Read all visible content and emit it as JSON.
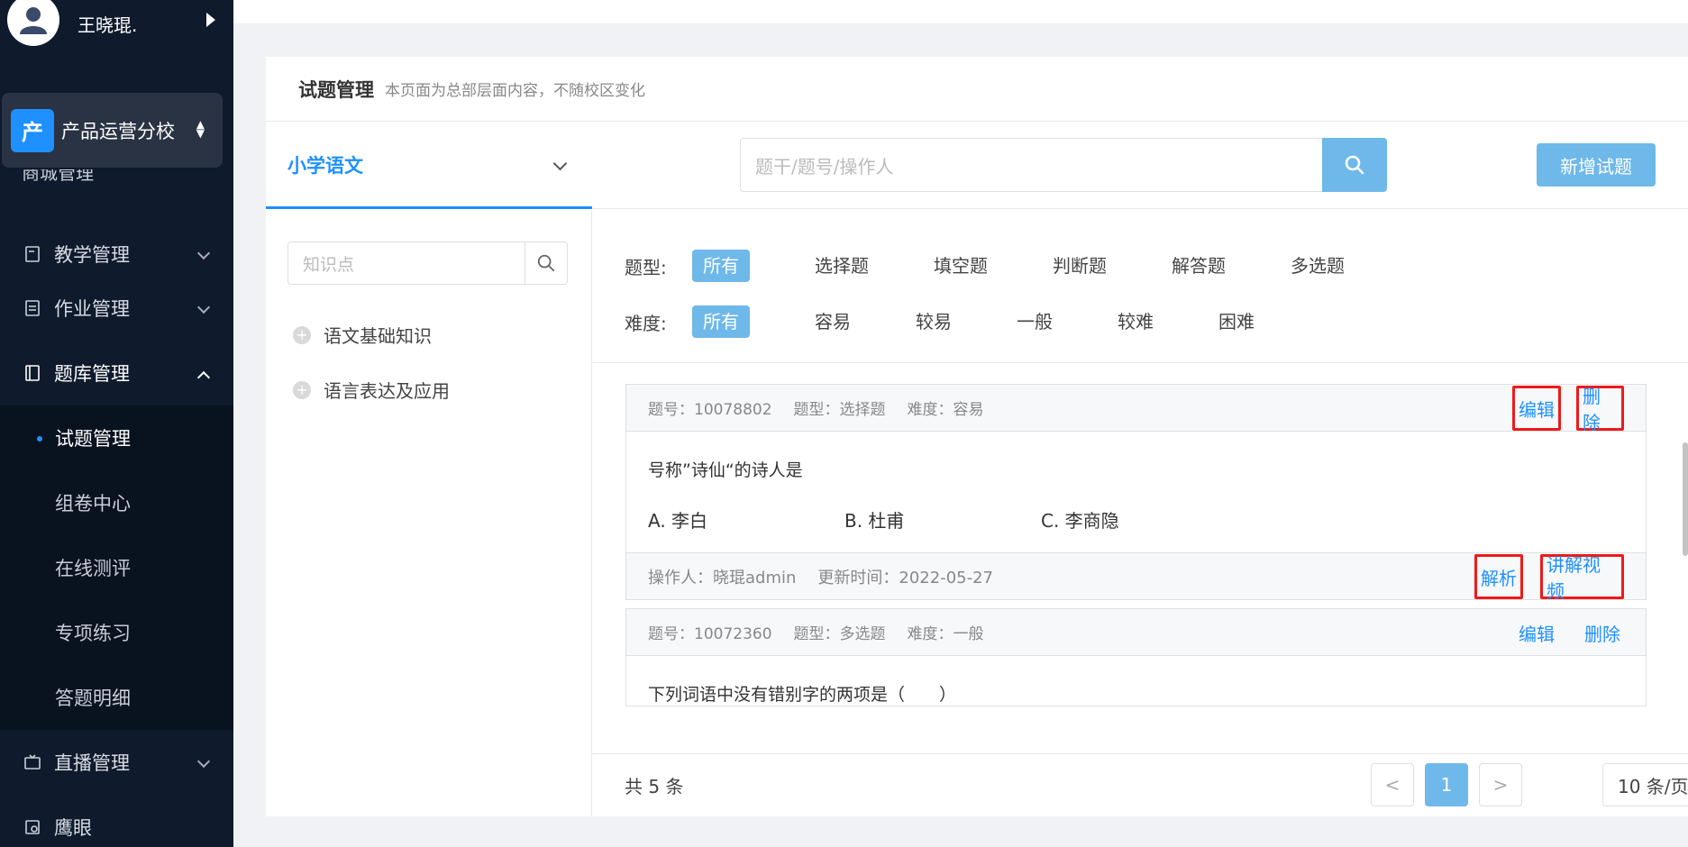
{
  "user": {
    "name": "王晓琨."
  },
  "school": {
    "logo_char": "产",
    "name": "产品运营分校"
  },
  "sidebar": {
    "partial_item": "商城管理",
    "items": [
      {
        "label": "教学管理"
      },
      {
        "label": "作业管理"
      },
      {
        "label": "题库管理"
      },
      {
        "label": "直播管理"
      },
      {
        "label": "鹰眼"
      }
    ],
    "subitems": [
      {
        "label": "试题管理"
      },
      {
        "label": "组卷中心"
      },
      {
        "label": "在线测评"
      },
      {
        "label": "专项练习"
      },
      {
        "label": "答题明细"
      }
    ]
  },
  "page": {
    "title": "试题管理",
    "description": "本页面为总部层面内容，不随校区变化",
    "subject": "小学语文",
    "search_placeholder": "题干/题号/操作人",
    "add_button": "新增试题",
    "kp_placeholder": "知识点"
  },
  "tree": [
    {
      "label": "语文基础知识"
    },
    {
      "label": "语言表达及应用"
    }
  ],
  "filters": {
    "type_label": "题型:",
    "types": [
      "所有",
      "选择题",
      "填空题",
      "判断题",
      "解答题",
      "多选题"
    ],
    "difficulty_label": "难度:",
    "difficulties": [
      "所有",
      "容易",
      "较易",
      "一般",
      "较难",
      "困难"
    ]
  },
  "questions": [
    {
      "id": "题号：10078802",
      "type": "题型：选择题",
      "difficulty": "难度：容易",
      "edit": "编辑",
      "delete": "删除",
      "stem": "号称”诗仙“的诗人是",
      "options": [
        "A.  李白",
        "B.  杜甫",
        "C.  李商隐"
      ],
      "operator": "操作人：晓琨admin",
      "updated": "更新时间：2022-05-27",
      "analysis": "解析",
      "video": "讲解视频"
    },
    {
      "id": "题号：10072360",
      "type": "题型：多选题",
      "difficulty": "难度：一般",
      "edit": "编辑",
      "delete": "删除",
      "stem": "下列词语中没有错别字的两项是（　　）"
    }
  ],
  "pagination": {
    "total": "共 5 条",
    "prev": "<",
    "current": "1",
    "next": ">",
    "page_size": "10 条/页"
  },
  "colors": {
    "accent": "#1e90ff",
    "button": "#6fb8ea",
    "highlight": "#ee1a1a",
    "sidebar": "#0f1b2d"
  }
}
